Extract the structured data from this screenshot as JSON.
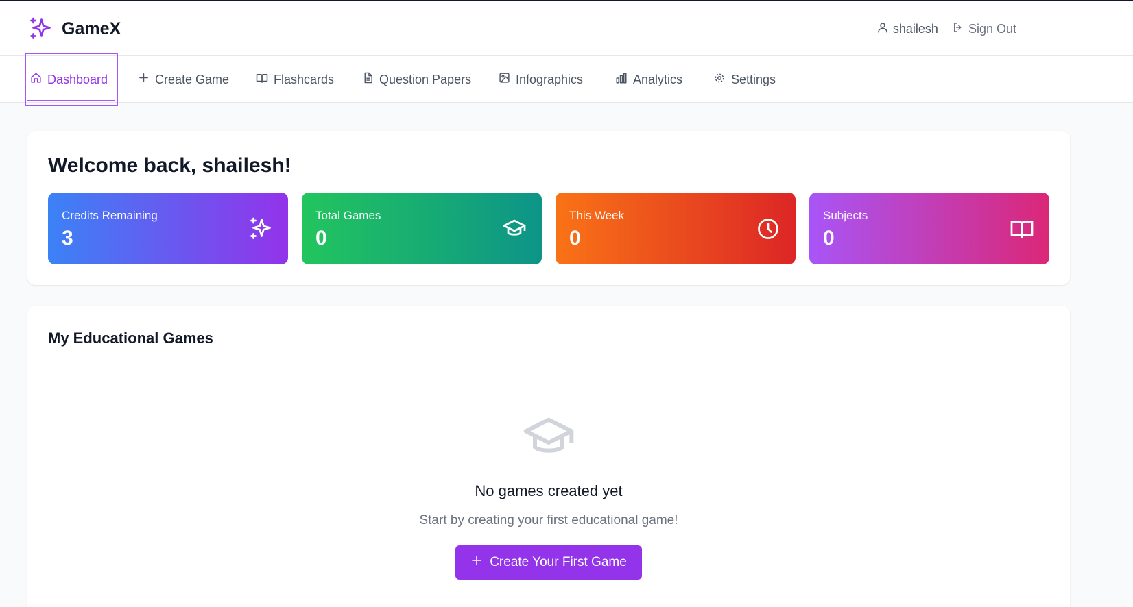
{
  "header": {
    "brand_name": "GameX",
    "username": "shailesh",
    "signout_label": "Sign Out"
  },
  "nav": {
    "items": [
      {
        "label": "Dashboard",
        "icon": "home-icon",
        "active": true
      },
      {
        "label": "Create Game",
        "icon": "plus-icon"
      },
      {
        "label": "Flashcards",
        "icon": "book-icon"
      },
      {
        "label": "Question Papers",
        "icon": "document-icon"
      },
      {
        "label": "Infographics",
        "icon": "image-icon"
      },
      {
        "label": "Analytics",
        "icon": "bar-chart-icon"
      },
      {
        "label": "Settings",
        "icon": "gear-icon"
      }
    ]
  },
  "welcome": {
    "title": "Welcome back, shailesh!",
    "stats": [
      {
        "label": "Credits Remaining",
        "value": "3",
        "icon": "sparkles-icon"
      },
      {
        "label": "Total Games",
        "value": "0",
        "icon": "graduation-cap-icon"
      },
      {
        "label": "This Week",
        "value": "0",
        "icon": "clock-icon"
      },
      {
        "label": "Subjects",
        "value": "0",
        "icon": "book-open-icon"
      }
    ]
  },
  "games": {
    "title": "My Educational Games",
    "empty_title": "No games created yet",
    "empty_subtitle": "Start by creating your first educational game!",
    "cta_label": "Create Your First Game"
  },
  "colors": {
    "accent": "#9333ea",
    "credits_gradient": [
      "#3b82f6",
      "#9333ea"
    ],
    "games_gradient": [
      "#22c55e",
      "#0d9488"
    ],
    "week_gradient": [
      "#f97316",
      "#dc2626"
    ],
    "subjects_gradient": [
      "#a855f7",
      "#db2777"
    ]
  }
}
